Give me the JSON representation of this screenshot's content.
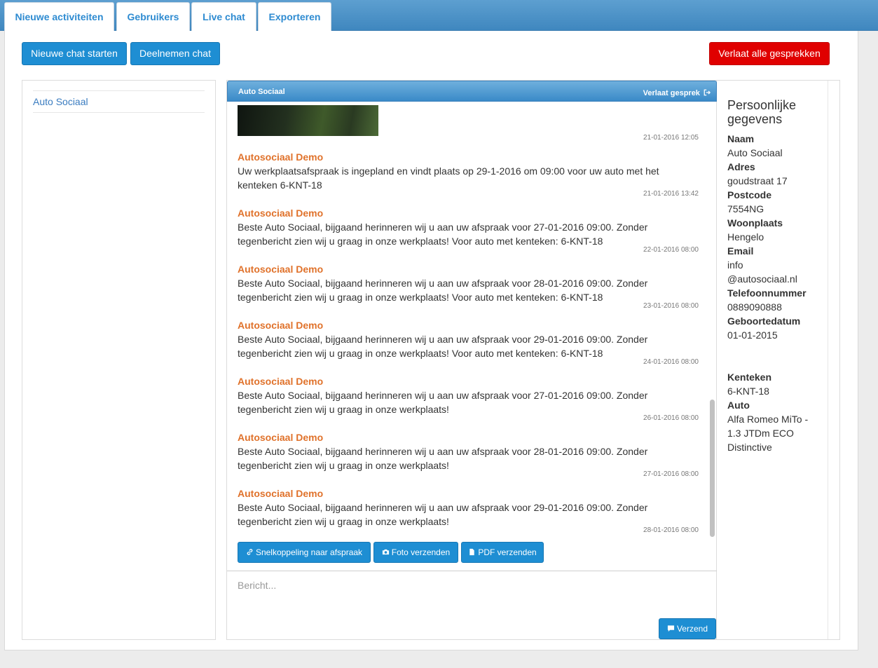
{
  "tabs": [
    {
      "label": "Nieuwe activiteiten"
    },
    {
      "label": "Gebruikers"
    },
    {
      "label": "Live chat"
    },
    {
      "label": "Exporteren"
    }
  ],
  "toolbar": {
    "new_chat": "Nieuwe chat starten",
    "join_chat": "Deelnemen chat",
    "leave_all": "Verlaat alle gesprekken"
  },
  "contacts": [
    {
      "name": "Auto Sociaal"
    }
  ],
  "chat": {
    "title": "Auto Sociaal",
    "leave": "Verlaat gesprek",
    "photo_timestamp": "21-01-2016 12:05",
    "messages": [
      {
        "sender": "Autosociaal Demo",
        "line1": "Uw werkplaatsafspraak is ingepland en vindt plaats op 29-1-2016 om 09:00 voor uw auto met het",
        "line2": "kenteken 6-KNT-18",
        "time": "21-01-2016 13:42"
      },
      {
        "sender": "Autosociaal Demo",
        "line1": "Beste Auto Sociaal, bijgaand herinneren wij u aan uw afspraak voor 27-01-2016 09:00. Zonder",
        "line2": "tegenbericht zien wij u graag in onze werkplaats! Voor auto met kenteken: 6-KNT-18",
        "time": "22-01-2016 08:00"
      },
      {
        "sender": "Autosociaal Demo",
        "line1": "Beste Auto Sociaal, bijgaand herinneren wij u aan uw afspraak voor 28-01-2016 09:00. Zonder",
        "line2": "tegenbericht zien wij u graag in onze werkplaats! Voor auto met kenteken: 6-KNT-18",
        "time": "23-01-2016 08:00"
      },
      {
        "sender": "Autosociaal Demo",
        "line1": "Beste Auto Sociaal, bijgaand herinneren wij u aan uw afspraak voor 29-01-2016 09:00. Zonder",
        "line2": "tegenbericht zien wij u graag in onze werkplaats! Voor auto met kenteken: 6-KNT-18",
        "time": "24-01-2016 08:00"
      },
      {
        "sender": "Autosociaal Demo",
        "line1": "Beste Auto Sociaal, bijgaand herinneren wij u aan uw afspraak voor 27-01-2016 09:00. Zonder",
        "line2": "tegenbericht zien wij u graag in onze werkplaats!",
        "time": "26-01-2016 08:00"
      },
      {
        "sender": "Autosociaal Demo",
        "line1": "Beste Auto Sociaal, bijgaand herinneren wij u aan uw afspraak voor 28-01-2016 09:00. Zonder",
        "line2": "tegenbericht zien wij u graag in onze werkplaats!",
        "time": "27-01-2016 08:00"
      },
      {
        "sender": "Autosociaal Demo",
        "line1": "Beste Auto Sociaal, bijgaand herinneren wij u aan uw afspraak voor 29-01-2016 09:00. Zonder",
        "line2": "tegenbericht zien wij u graag in onze werkplaats!",
        "time": "28-01-2016 08:00"
      }
    ],
    "actions": {
      "shortcut": "Snelkoppeling naar afspraak",
      "photo": "Foto verzenden",
      "pdf": "PDF verzenden"
    },
    "composer_placeholder": "Bericht...",
    "send": "Verzend"
  },
  "info": {
    "title": "Persoonlijke gegevens",
    "name_label": "Naam",
    "name": "Auto Sociaal",
    "address_label": "Adres",
    "address": "goudstraat 17",
    "postcode_label": "Postcode",
    "postcode": "7554NG",
    "city_label": "Woonplaats",
    "city": "Hengelo",
    "email_label": "Email",
    "email_1": "info",
    "email_2": "@autosociaal.nl",
    "phone_label": "Telefoonnummer",
    "phone": "0889090888",
    "birth_label": "Geboortedatum",
    "birth": "01-01-2015",
    "plate_label": "Kenteken",
    "plate": "6-KNT-18",
    "car_label": "Auto",
    "car_1": "Alfa Romeo MiTo -",
    "car_2": "1.3 JTDm ECO",
    "car_3": "Distinctive"
  },
  "colors": {
    "accent": "#1e8ed3",
    "danger": "#e00000",
    "sender": "#e0722b"
  }
}
